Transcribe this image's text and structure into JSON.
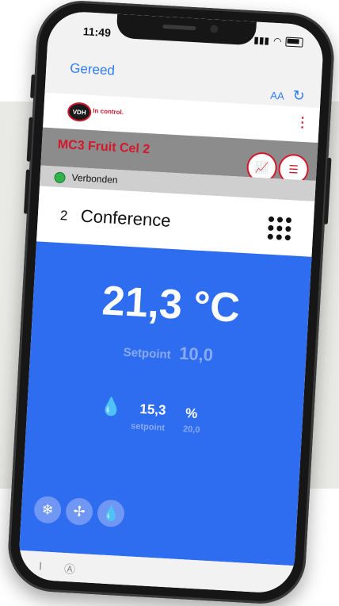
{
  "status_bar": {
    "time": "11:49"
  },
  "nav": {
    "done_label": "Gereed",
    "text_size_label": "AA",
    "reload_icon": "reload-icon"
  },
  "header": {
    "logo_text": "VDH",
    "brand_text": "In control.",
    "menu_icon": "kebab-icon"
  },
  "device": {
    "name": "MC3 Fruit Cel 2",
    "chart_button_icon": "chart-icon",
    "list_button_icon": "list-icon",
    "connection_status": "Verbonden",
    "connection_color": "#2fb34a"
  },
  "room": {
    "number": "2",
    "name": "Conference",
    "grid_icon": "grid-icon"
  },
  "climate": {
    "temperature": "21,3 °C",
    "setpoint_label": "Setpoint",
    "setpoint_value": "10,0",
    "humidity_value": "15,3",
    "humidity_unit": "%",
    "humidity_setpoint_label": "setpoint",
    "humidity_setpoint_value": "20,0"
  },
  "modes": [
    {
      "icon": "snowflake-icon",
      "glyph": "❄"
    },
    {
      "icon": "fan-icon",
      "glyph": "✢"
    },
    {
      "icon": "droplets-icon",
      "glyph": "💧"
    }
  ],
  "colors": {
    "accent": "#d3182b",
    "panel": "#2f6df0",
    "ios_blue": "#2f7cf6"
  }
}
